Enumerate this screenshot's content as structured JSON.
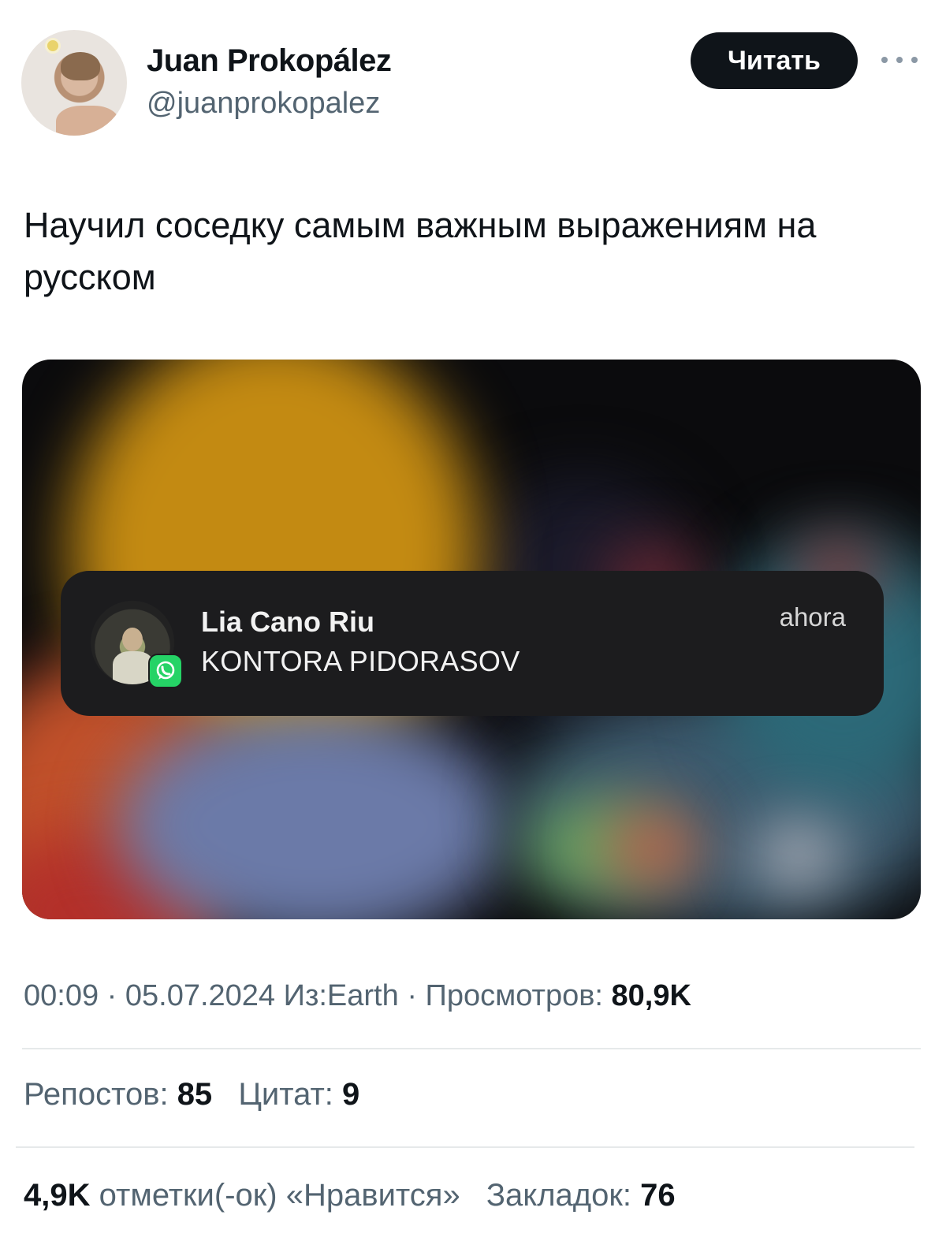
{
  "author": {
    "name": "Juan Prokopález",
    "handle": "@juanprokopalez"
  },
  "actions": {
    "follow_label": "Читать",
    "more_icon": "more-dots-icon"
  },
  "tweet": {
    "text": "Научил соседку самым важным выражениям на русском"
  },
  "media": {
    "notification": {
      "sender": "Lia Cano Riu",
      "message": "KONTORA PIDORASOV",
      "time": "ahora",
      "app_icon": "whatsapp-icon"
    }
  },
  "meta": {
    "time": "00:09",
    "separator": "·",
    "date": "05.07.2024",
    "source": "Из:Earth",
    "views_label": "Просмотров:",
    "views_value": "80,9K"
  },
  "stats": {
    "reposts_label": "Репостов:",
    "reposts_value": "85",
    "quotes_label": "Цитат:",
    "quotes_value": "9",
    "likes_value": "4,9K",
    "likes_label": "отметки(-ок) «Нравится»",
    "bookmarks_label": "Закладок:",
    "bookmarks_value": "76"
  },
  "colors": {
    "text_primary": "#0f1419",
    "text_secondary": "#536471",
    "button_bg": "#0f1419",
    "notification_bg": "#1c1c1e",
    "whatsapp_green": "#25d366"
  }
}
